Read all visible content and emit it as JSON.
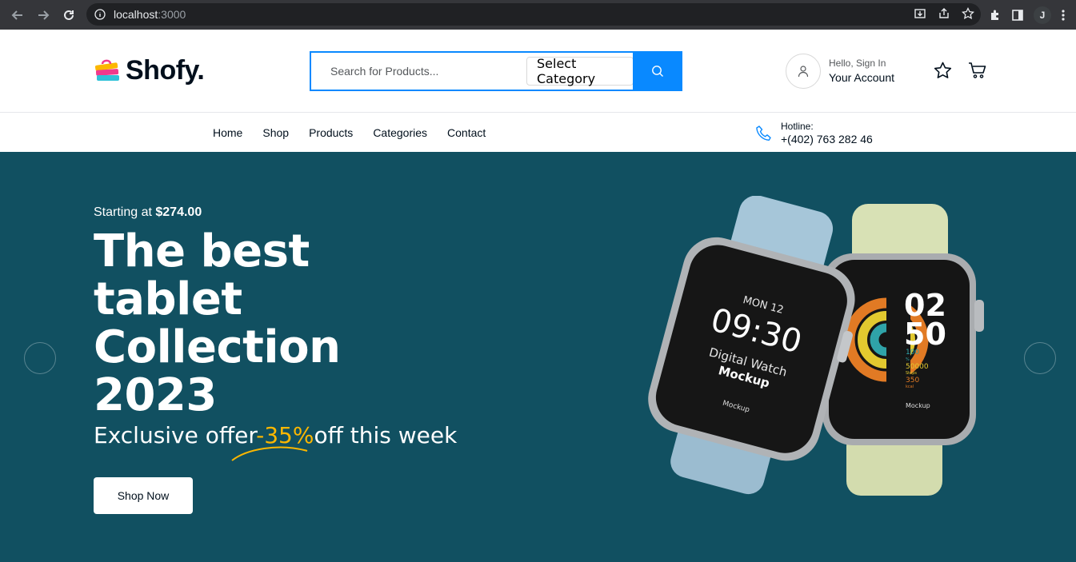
{
  "browser": {
    "url_host": "localhost",
    "url_port": ":3000",
    "profile_initial": "J"
  },
  "header": {
    "logo_text": "Shofy.",
    "search_placeholder": "Search for Products...",
    "category_label": "Select Category",
    "account_hello": "Hello, Sign In",
    "account_title": "Your Account"
  },
  "nav": {
    "items": [
      "Home",
      "Shop",
      "Products",
      "Categories",
      "Contact"
    ],
    "hotline_label": "Hotline:",
    "hotline_number": "+(402) 763 282 46"
  },
  "hero": {
    "pre_prefix": "Starting at ",
    "pre_price": "$274.00",
    "title_lines": [
      "The best",
      "tablet",
      "Collection",
      "2023"
    ],
    "offer_prefix": "Exclusive offer",
    "offer_highlight": "-35%",
    "offer_suffix": "off this week",
    "cta_label": "Shop Now",
    "watch_left": {
      "day": "MON 12",
      "time": "09:30",
      "label1": "Digital Watch",
      "label2": "Mockup",
      "footer": "Mockup"
    },
    "watch_right": {
      "hour": "02",
      "minute": "50",
      "stat1": "100",
      "stat1_unit": "%",
      "stat2": "50000",
      "stat2_unit": "Steps",
      "stat3": "350",
      "stat3_unit": "kcal",
      "footer": "Mockup"
    }
  },
  "colors": {
    "brand_blue": "#0989ff",
    "hero_bg": "#115061",
    "offer_highlight": "#fcb700"
  }
}
